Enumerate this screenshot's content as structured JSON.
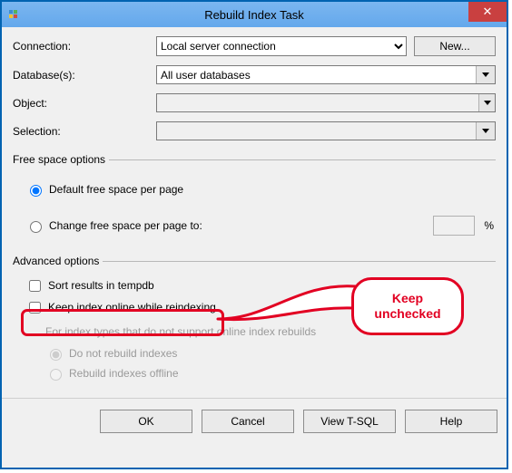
{
  "window": {
    "title": "Rebuild Index Task",
    "close_glyph": "✕"
  },
  "form": {
    "connection_label": "Connection:",
    "connection_value": "Local server connection",
    "new_button": "New...",
    "databases_label": "Database(s):",
    "databases_value": "All user databases",
    "object_label": "Object:",
    "object_value": "",
    "selection_label": "Selection:",
    "selection_value": ""
  },
  "freespace": {
    "legend": "Free space options",
    "default_label": "Default free space per page",
    "change_label": "Change free space per page to:",
    "percent_sign": "%"
  },
  "advanced": {
    "legend": "Advanced options",
    "sort_tempdb": "Sort results in tempdb",
    "keep_online": "Keep index online while reindexing",
    "note": "For index types that do not support online index rebuilds",
    "opt_no_rebuild": "Do not rebuild indexes",
    "opt_rebuild_offline": "Rebuild indexes offline"
  },
  "buttons": {
    "ok": "OK",
    "cancel": "Cancel",
    "view_tsql": "View T-SQL",
    "help": "Help"
  },
  "annotation": {
    "text": "Keep unchecked"
  }
}
